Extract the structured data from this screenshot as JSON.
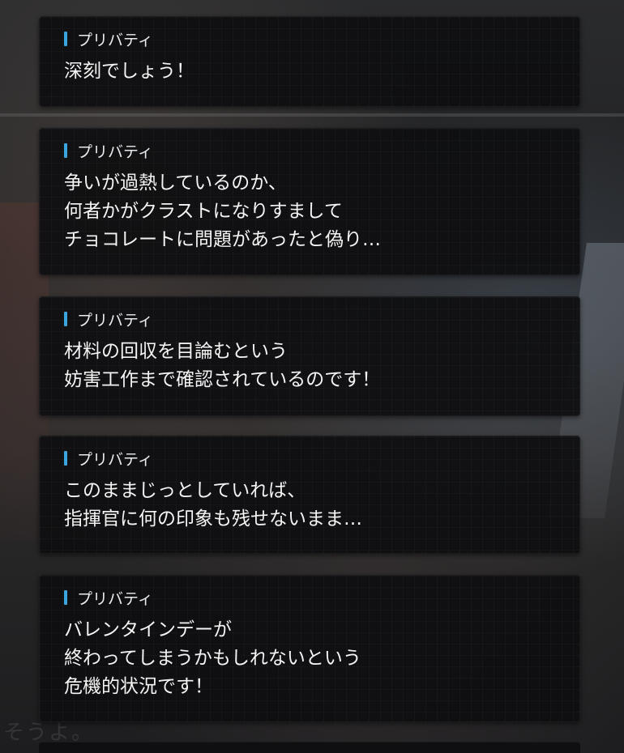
{
  "watermark_text": "そうよ。",
  "accent_color": "#3aa6e0",
  "entries": [
    {
      "speaker": "プリバティ",
      "lines": [
        "深刻でしょう！"
      ]
    },
    {
      "speaker": "プリバティ",
      "lines": [
        "争いが過熱しているのか、",
        "何者かがクラストになりすまして",
        "チョコレートに問題があったと偽り…"
      ]
    },
    {
      "speaker": "プリバティ",
      "lines": [
        "材料の回収を目論むという",
        "妨害工作まで確認されているのです！"
      ]
    },
    {
      "speaker": "プリバティ",
      "lines": [
        "このままじっとしていれば、",
        "指揮官に何の印象も残せないまま…"
      ]
    },
    {
      "speaker": "プリバティ",
      "lines": [
        "バレンタインデーが",
        "終わってしまうかもしれないという",
        "危機的状況です！"
      ]
    }
  ]
}
